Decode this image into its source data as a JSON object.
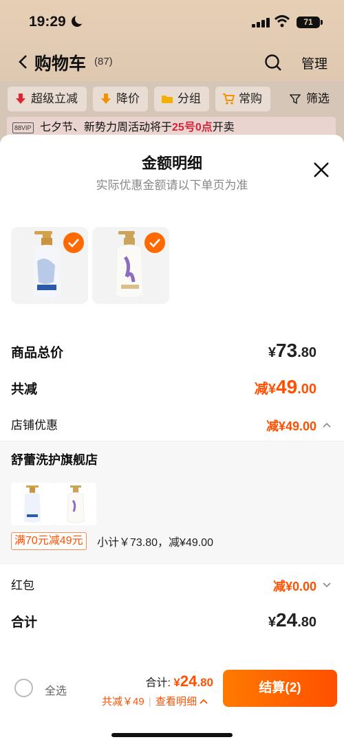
{
  "status_bar": {
    "time": "19:29",
    "battery": "71"
  },
  "nav": {
    "title": "购物车",
    "count": "(87)",
    "manage": "管理"
  },
  "filters": [
    {
      "label": "超级立减",
      "icon": "red-arrow-down-icon"
    },
    {
      "label": "降价",
      "icon": "orange-arrow-down-icon"
    },
    {
      "label": "分组",
      "icon": "folder-icon"
    },
    {
      "label": "常购",
      "icon": "cart-icon"
    },
    {
      "label": "筛选",
      "icon": "funnel-icon"
    }
  ],
  "banner": {
    "vip": "88VIP",
    "text_before": "七夕节、新势力周活动将于",
    "highlight": "25号0点",
    "text_after": "开卖"
  },
  "sheet": {
    "title": "金额明细",
    "subtitle": "实际优惠金额请以下单页为准",
    "rows": {
      "total_price": {
        "label": "商品总价",
        "symbol": "¥",
        "integer": "73",
        "decimal": ".80"
      },
      "total_discount": {
        "label": "共减",
        "prefix": "减¥",
        "integer": "49",
        "decimal": ".00"
      },
      "store_discount": {
        "label": "店铺优惠",
        "value": "减¥49.00"
      },
      "red_packet": {
        "label": "红包",
        "value": "减¥0.00"
      },
      "grand_total": {
        "label": "合计",
        "symbol": "¥",
        "integer": "24",
        "decimal": ".80"
      }
    },
    "store": {
      "name": "舒蕾洗护旗舰店",
      "promo": "满70元减49元",
      "subtotal": "小计￥73.80，减¥49.00"
    }
  },
  "footer": {
    "select_all": "全选",
    "total_label": "合计: ",
    "total_symbol": "¥",
    "total_integer": "24",
    "total_decimal": ".80",
    "saved": "共减￥49",
    "divider": "|",
    "detail": "查看明细",
    "checkout": "结算(2)"
  },
  "colors": {
    "accent": "#ff5000",
    "promo_red": "#d6233a"
  }
}
